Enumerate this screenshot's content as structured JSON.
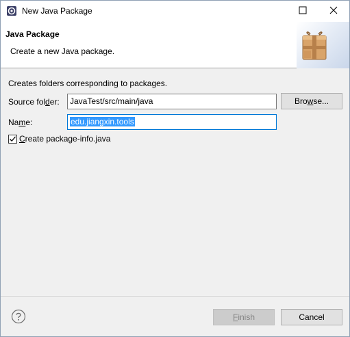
{
  "window": {
    "title": "New Java Package"
  },
  "banner": {
    "title": "Java Package",
    "description": "Create a new Java package."
  },
  "form": {
    "hint": "Creates folders corresponding to packages.",
    "source_label_pre": "Source fol",
    "source_label_key": "d",
    "source_label_post": "er:",
    "source_value": "JavaTest/src/main/java",
    "name_label_pre": "Na",
    "name_label_key": "m",
    "name_label_post": "e:",
    "name_value": "edu.jiangxin.tools",
    "browse_key": "w",
    "browse_pre": "Bro",
    "browse_post": "se...",
    "create_info_key": "C",
    "create_info_post": "reate package-info.java",
    "create_info_checked": true
  },
  "footer": {
    "finish_key": "F",
    "finish_post": "inish",
    "cancel_label": "Cancel"
  },
  "colors": {
    "selection": "#3399ff",
    "focus_border": "#0078d7"
  }
}
